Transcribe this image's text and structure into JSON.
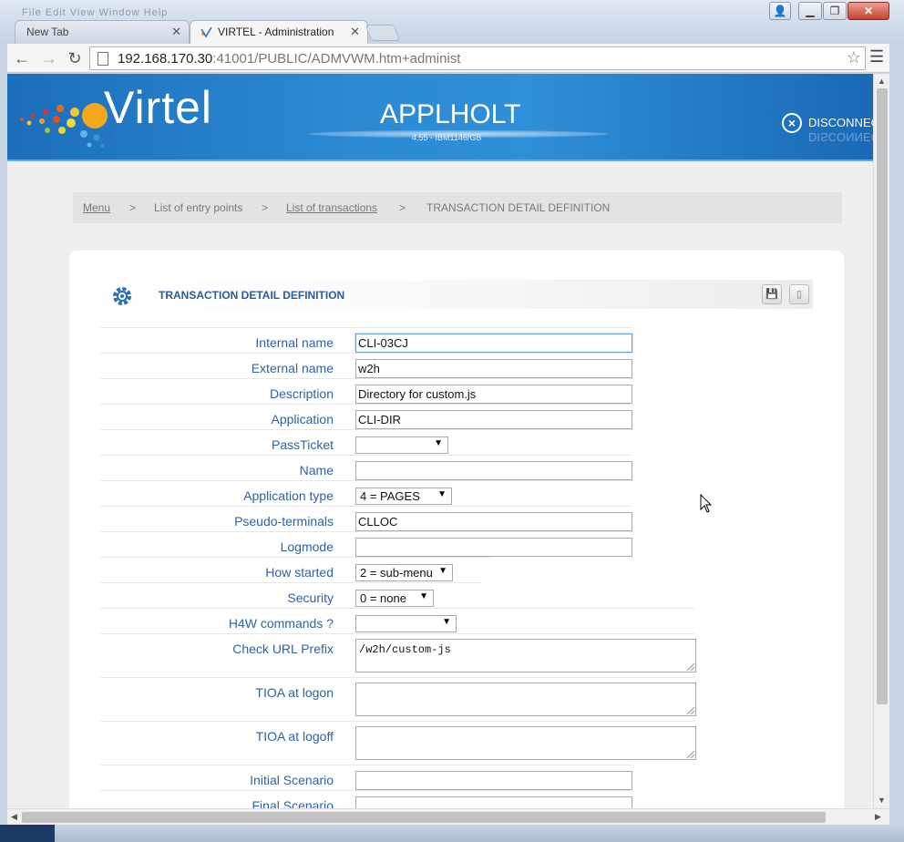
{
  "browser": {
    "ghost_menu": "File   Edit   View   Window   Help",
    "tabs": [
      {
        "label": "New Tab",
        "active": false
      },
      {
        "label": "VIRTEL - Administration",
        "active": true
      }
    ],
    "url_host": "192.168.170.30",
    "url_rest": ":41001/PUBLIC/ADMVWM.htm+administ"
  },
  "header": {
    "logo": "Virtel",
    "app_title": "APPLHOLT",
    "app_subtitle": "4.55 - IBM1146/GB",
    "disconnect": "DISCONNECT"
  },
  "breadcrumb": {
    "menu": "Menu",
    "sep": ">",
    "entry_points": "List of entry points",
    "transactions": "List of transactions",
    "current": "TRANSACTION DETAIL DEFINITION"
  },
  "panel": {
    "title": "TRANSACTION DETAIL DEFINITION"
  },
  "form": {
    "internal_name": {
      "label": "Internal name",
      "value": "CLI-03CJ"
    },
    "external_name": {
      "label": "External name",
      "value": "w2h"
    },
    "description": {
      "label": "Description",
      "value": "Directory for custom.js"
    },
    "application": {
      "label": "Application",
      "value": "CLI-DIR"
    },
    "passticket": {
      "label": "PassTicket",
      "value": ""
    },
    "name": {
      "label": "Name",
      "value": ""
    },
    "application_type": {
      "label": "Application type",
      "value": "4 = PAGES"
    },
    "pseudo_terminals": {
      "label": "Pseudo-terminals",
      "value": "CLLOC"
    },
    "logmode": {
      "label": "Logmode",
      "value": ""
    },
    "how_started": {
      "label": "How started",
      "value": "2 = sub-menu"
    },
    "security": {
      "label": "Security",
      "value": "0 = none"
    },
    "h4w_commands": {
      "label": "H4W commands ?",
      "value": ""
    },
    "check_url_prefix": {
      "label": "Check URL Prefix",
      "value": "/w2h/custom-js"
    },
    "tioa_logon": {
      "label": "TIOA at logon",
      "value": ""
    },
    "tioa_logoff": {
      "label": "TIOA at logoff",
      "value": ""
    },
    "initial_scenario": {
      "label": "Initial Scenario",
      "value": ""
    },
    "final_scenario": {
      "label": "Final Scenario",
      "value": ""
    }
  },
  "icons": {
    "gear": "gear-icon",
    "save": "save-icon",
    "phone": "phone-icon",
    "disconnect": "close-circle-icon"
  },
  "colors": {
    "banner": "#2c8ad4",
    "label": "#2f62a4",
    "title": "#2a5c9a"
  }
}
